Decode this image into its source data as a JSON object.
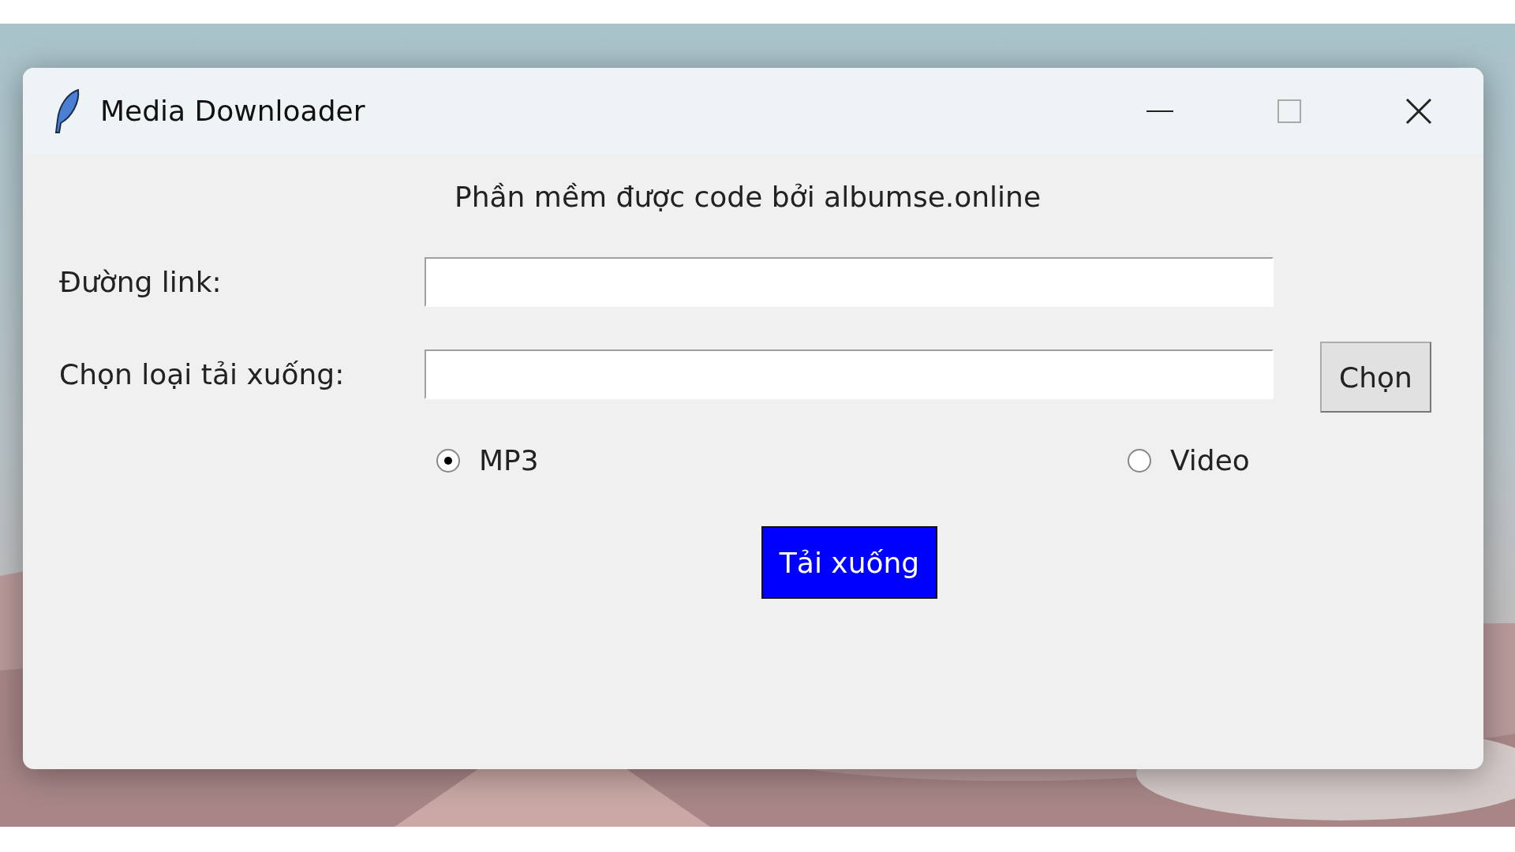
{
  "window": {
    "title": "Media Downloader"
  },
  "tagline": "Phần mềm được code bởi albumse.online",
  "fields": [
    {
      "label": "Đường link:"
    },
    {
      "label": "Chọn loại tải xuống:"
    }
  ],
  "choose_button": "Chọn",
  "formats": [
    {
      "label": "MP3",
      "selected": true
    },
    {
      "label": "Video",
      "selected": false
    }
  ],
  "download_button": "Tải xuống"
}
